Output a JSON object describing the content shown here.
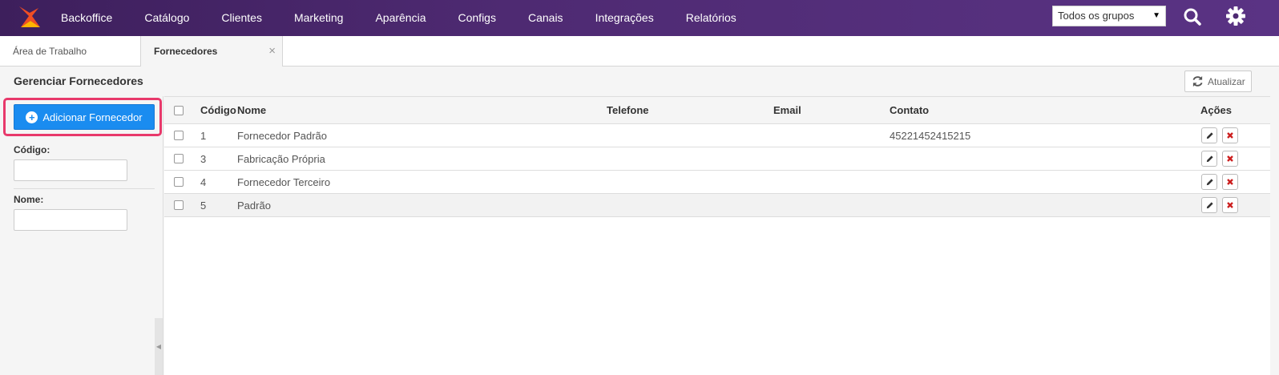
{
  "nav": {
    "items": [
      "Backoffice",
      "Catálogo",
      "Clientes",
      "Marketing",
      "Aparência",
      "Configs",
      "Canais",
      "Integrações",
      "Relatórios"
    ],
    "group_select": "Todos os grupos"
  },
  "tabs": {
    "desktop": "Área de Trabalho",
    "active": "Fornecedores",
    "close": "×"
  },
  "page": {
    "title": "Gerenciar Fornecedores",
    "refresh_label": "Atualizar"
  },
  "sidebar": {
    "add_label": "Adicionar Fornecedor",
    "code_label": "Código:",
    "name_label": "Nome:"
  },
  "table": {
    "headers": {
      "code": "Código",
      "name": "Nome",
      "phone": "Telefone",
      "email": "Email",
      "contact": "Contato",
      "actions": "Ações"
    },
    "rows": [
      {
        "code": "1",
        "name": "Fornecedor Padrão",
        "phone": "",
        "email": "",
        "contact": "45221452415215"
      },
      {
        "code": "3",
        "name": "Fabricação Própria",
        "phone": "",
        "email": "",
        "contact": ""
      },
      {
        "code": "4",
        "name": "Fornecedor Terceiro",
        "phone": "",
        "email": "",
        "contact": ""
      },
      {
        "code": "5",
        "name": "Padrão",
        "phone": "",
        "email": "",
        "contact": ""
      }
    ]
  },
  "colors": {
    "topbar": "#4e2a72",
    "primary_button": "#1a8cf0",
    "highlight": "#e8396b",
    "delete": "#cc1f1f"
  }
}
